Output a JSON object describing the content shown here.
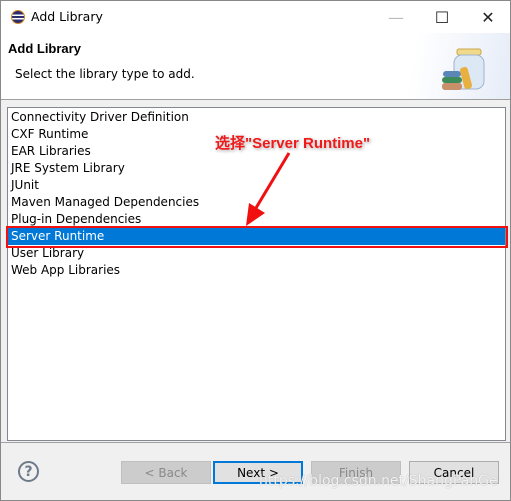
{
  "window": {
    "title": "Add Library",
    "minimize_icon": "minimize-icon",
    "maximize_icon": "maximize-icon",
    "close_icon": "close-icon"
  },
  "header": {
    "title": "Add Library",
    "description": "Select the library type to add."
  },
  "list": {
    "items": [
      "Connectivity Driver Definition",
      "CXF Runtime",
      "EAR Libraries",
      "JRE System Library",
      "JUnit",
      "Maven Managed Dependencies",
      "Plug-in Dependencies",
      "Server Runtime",
      "User Library",
      "Web App Libraries"
    ],
    "selected": "Server Runtime",
    "selection_color": "#0078d7"
  },
  "annotation": {
    "text": "选择\"Server Runtime\"",
    "color": "#f01818"
  },
  "buttons": {
    "help": "?",
    "back": "< Back",
    "next": "Next >",
    "finish": "Finish",
    "cancel": "Cancel"
  },
  "watermark": "https://blog.csdn.net/ShangPanGe"
}
